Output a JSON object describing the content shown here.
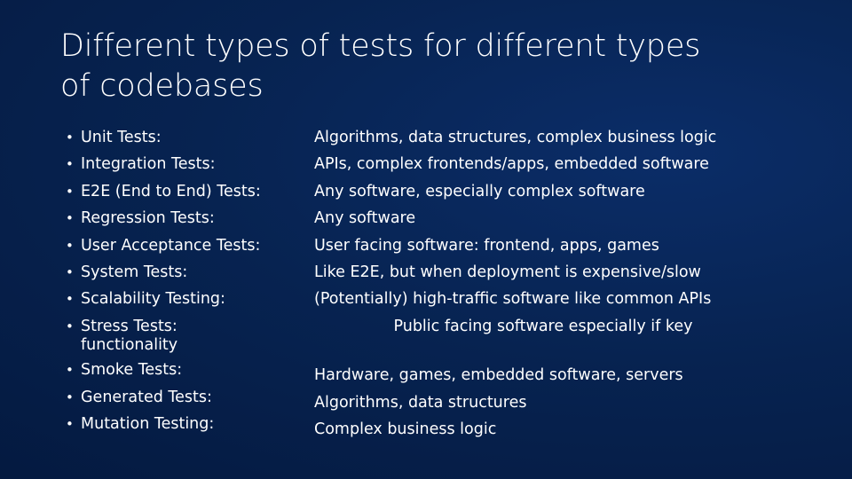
{
  "slide": {
    "title": "Different types of tests for different types\nof codebases",
    "background_color": "#06214f",
    "background_accent_color": "#0b2d68",
    "text_color": "#ffffff",
    "bullet_glyph": "•"
  },
  "left_column": {
    "items": [
      {
        "label": "Unit Tests:",
        "continuation": ""
      },
      {
        "label": "Integration Tests:",
        "continuation": ""
      },
      {
        "label": "E2E (End to End) Tests:",
        "continuation": ""
      },
      {
        "label": "Regression Tests:",
        "continuation": ""
      },
      {
        "label": "User Acceptance Tests:",
        "continuation": ""
      },
      {
        "label": "System Tests:",
        "continuation": ""
      },
      {
        "label": "Scalability Testing:",
        "continuation": ""
      },
      {
        "label": "Stress Tests:",
        "continuation": "functionality"
      },
      {
        "label": "Smoke Tests:",
        "continuation": ""
      },
      {
        "label": "Generated Tests:",
        "continuation": ""
      },
      {
        "label": "Mutation Testing:",
        "continuation": ""
      }
    ]
  },
  "right_column": {
    "lines": [
      {
        "text": "Algorithms, data structures, complex business logic",
        "align": "left"
      },
      {
        "text": "APIs, complex frontends/apps, embedded software",
        "align": "left"
      },
      {
        "text": "Any software, especially complex software",
        "align": "left"
      },
      {
        "text": "Any software",
        "align": "left"
      },
      {
        "text": "User facing software: frontend, apps, games",
        "align": "left"
      },
      {
        "text": "Like E2E, but when deployment is expensive/slow",
        "align": "left"
      },
      {
        "text": "(Potentially) high-traffic software like common APIs",
        "align": "left"
      },
      {
        "text": "Public facing software especially if key",
        "align": "center"
      },
      {
        "text": "Hardware, games, embedded software, servers",
        "align": "left"
      },
      {
        "text": "Algorithms, data structures",
        "align": "left"
      },
      {
        "text": "Complex business logic",
        "align": "left"
      }
    ]
  }
}
